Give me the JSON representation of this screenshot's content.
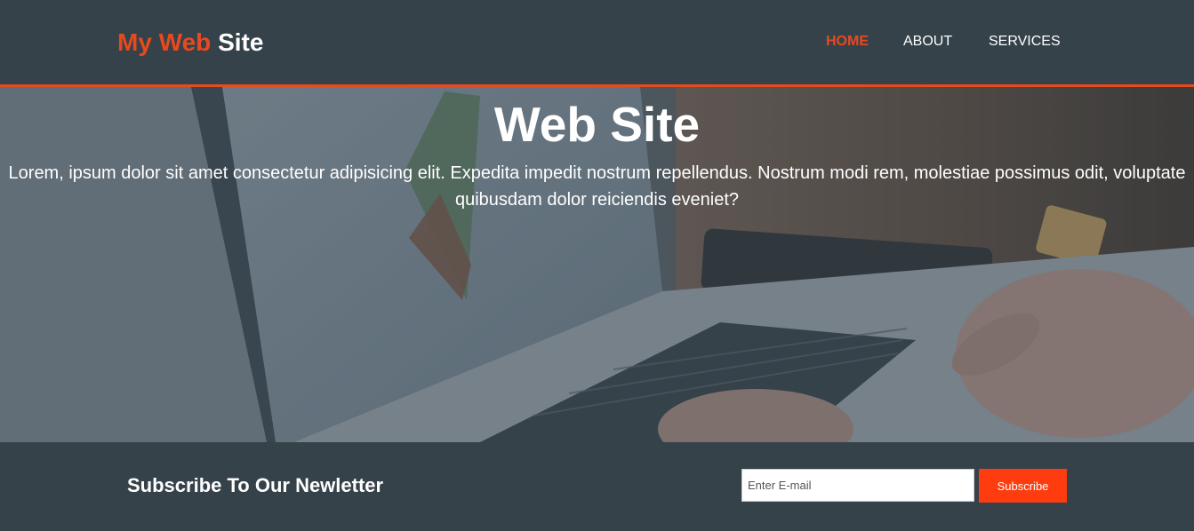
{
  "header": {
    "logo": {
      "highlight": "My Web",
      "rest": "Site"
    },
    "nav": [
      {
        "label": "HOME",
        "active": true
      },
      {
        "label": "ABOUT",
        "active": false
      },
      {
        "label": "SERVICES",
        "active": false
      }
    ]
  },
  "hero": {
    "title": "Web Site",
    "text": "Lorem, ipsum dolor sit amet consectetur adipisicing elit. Expedita impedit nostrum repellendus. Nostrum modi rem, molestiae possimus odit, voluptate quibusdam dolor reiciendis eveniet?",
    "background_image": "laptop-workspace-photo"
  },
  "newsletter": {
    "title": "Subscribe To Our Newletter",
    "email_placeholder": "Enter E-mail",
    "email_value": "",
    "button_label": "Subscribe"
  },
  "colors": {
    "dark": "#35424a",
    "accent": "#e8491d",
    "button": "#ff3c0f",
    "text": "#ffffff"
  }
}
